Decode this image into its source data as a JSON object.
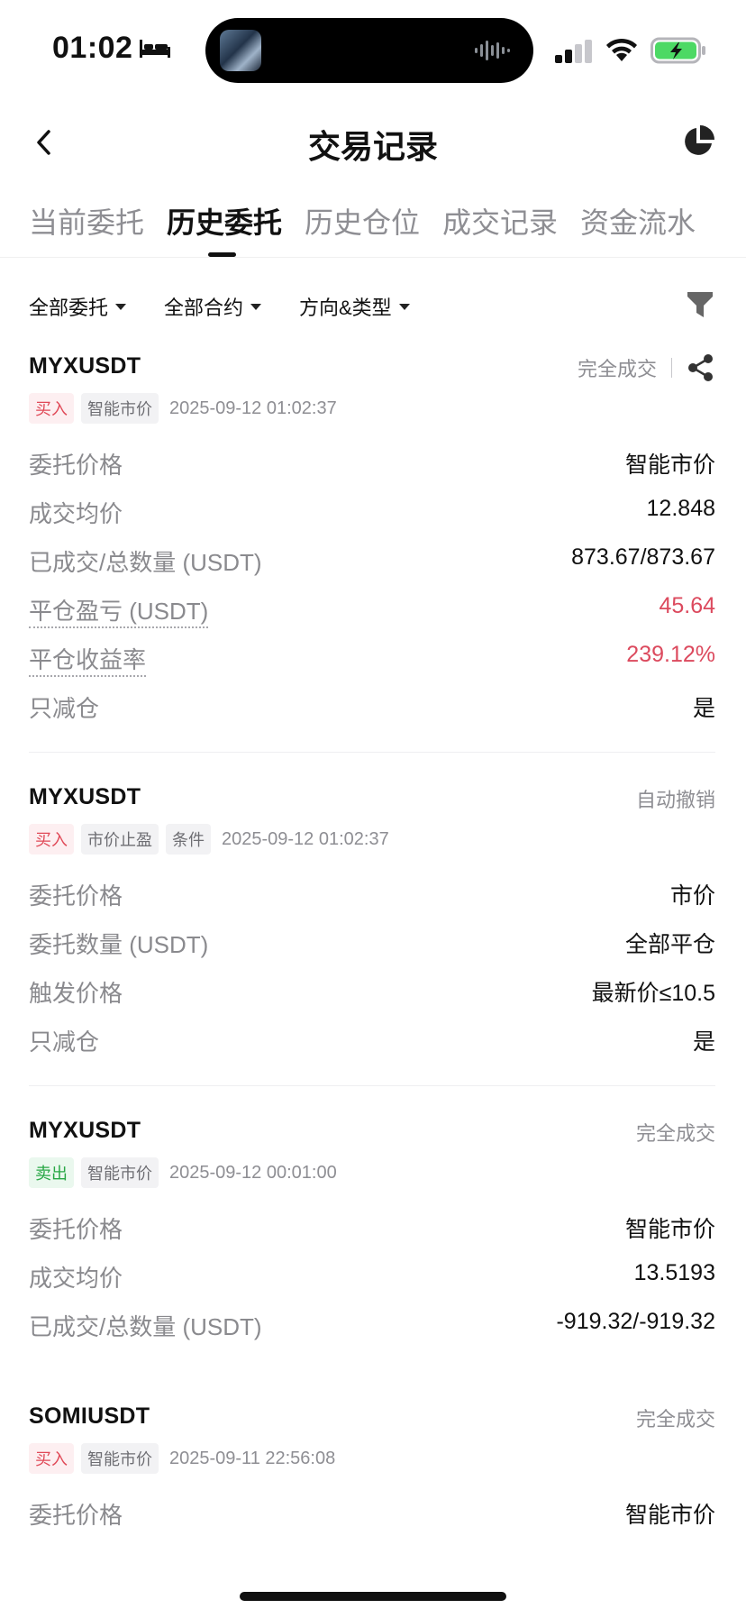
{
  "status_bar": {
    "time": "01:02",
    "colors": {
      "battery_fill": "#4cd964"
    }
  },
  "header": {
    "title": "交易记录",
    "icons": {
      "back": "chevron-left-icon",
      "chart": "pie-chart-icon"
    }
  },
  "tabs": [
    {
      "label": "当前委托",
      "active": false
    },
    {
      "label": "历史委托",
      "active": true
    },
    {
      "label": "历史仓位",
      "active": false
    },
    {
      "label": "成交记录",
      "active": false
    },
    {
      "label": "资金流水",
      "active": false
    }
  ],
  "filters": {
    "all_orders": "全部委托",
    "all_contracts": "全部合约",
    "direction_type": "方向&类型"
  },
  "orders": [
    {
      "symbol": "MYXUSDT",
      "status": "完全成交",
      "tags": [
        "买入",
        "智能市价"
      ],
      "time": "2025-09-12 01:02:37",
      "rows": [
        {
          "label": "委托价格",
          "value": "智能市价"
        },
        {
          "label": "成交均价",
          "value": "12.848"
        },
        {
          "label": "已成交/总数量 (USDT)",
          "value": "873.67/873.67"
        },
        {
          "label": "平仓盈亏 (USDT)",
          "value": "45.64"
        },
        {
          "label": "平仓收益率",
          "value": "239.12%"
        },
        {
          "label": "只减仓",
          "value": "是"
        }
      ]
    },
    {
      "symbol": "MYXUSDT",
      "status": "自动撤销",
      "tags": [
        "买入",
        "市价止盈",
        "条件"
      ],
      "time": "2025-09-12 01:02:37",
      "rows": [
        {
          "label": "委托价格",
          "value": "市价"
        },
        {
          "label": "委托数量 (USDT)",
          "value": "全部平仓"
        },
        {
          "label": "触发价格",
          "value": "最新价≤10.5"
        },
        {
          "label": "只减仓",
          "value": "是"
        }
      ]
    },
    {
      "symbol": "MYXUSDT",
      "status": "完全成交",
      "tags": [
        "卖出",
        "智能市价"
      ],
      "time": "2025-09-12 00:01:00",
      "rows": [
        {
          "label": "委托价格",
          "value": "智能市价"
        },
        {
          "label": "成交均价",
          "value": "13.5193"
        },
        {
          "label": "已成交/总数量 (USDT)",
          "value": "-919.32/-919.32"
        }
      ]
    },
    {
      "symbol": "SOMIUSDT",
      "status": "完全成交",
      "tags": [
        "买入",
        "智能市价"
      ],
      "time": "2025-09-11 22:56:08",
      "rows": [
        {
          "label": "委托价格",
          "value": "智能市价"
        }
      ]
    }
  ],
  "colors": {
    "profit_red": "#dc4a5e",
    "buy_tag": "#e04a58",
    "sell_tag": "#28a745"
  }
}
